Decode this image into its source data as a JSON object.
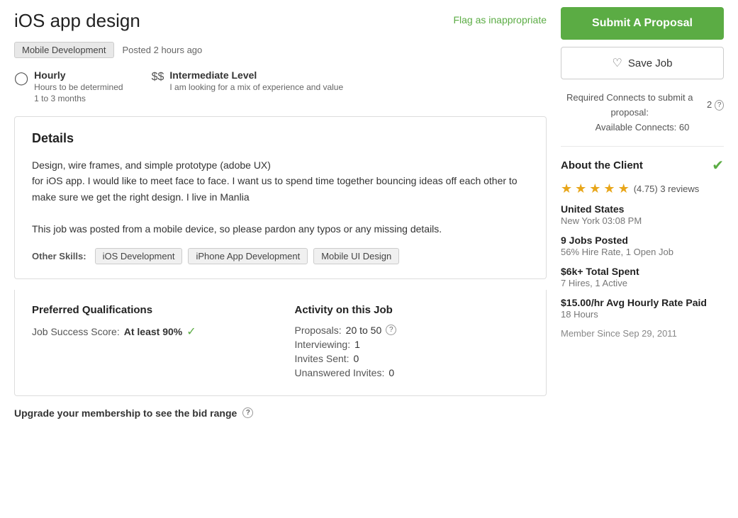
{
  "header": {
    "job_title": "iOS app design",
    "flag_label": "Flag as inappropriate"
  },
  "meta": {
    "category": "Mobile Development",
    "posted": "Posted 2 hours ago"
  },
  "job_type": {
    "type_label": "Hourly",
    "type_sub1": "Hours to be determined",
    "type_sub2": "1 to 3 months",
    "level_label": "Intermediate Level",
    "level_sub": "I am looking for a mix of experience and value"
  },
  "details": {
    "title": "Details",
    "description_line1": "Design, wire frames, and simple prototype (adobe UX)",
    "description_line2": "for iOS app. I would like to meet face to face.  I want us to spend time together bouncing ideas off each other to make sure we get the right design.  I live in Manlia",
    "description_line3": "",
    "description_line4": "This job was posted from a mobile device, so please pardon any typos or any missing details.",
    "other_skills_label": "Other Skills:",
    "skills": [
      "iOS Development",
      "iPhone App Development",
      "Mobile UI Design"
    ]
  },
  "qualifications": {
    "title": "Preferred Qualifications",
    "job_success_label": "Job Success Score:",
    "job_success_value": "At least 90%"
  },
  "activity": {
    "title": "Activity on this Job",
    "proposals_label": "Proposals:",
    "proposals_value": "20 to 50",
    "interviewing_label": "Interviewing:",
    "interviewing_value": "1",
    "invites_sent_label": "Invites Sent:",
    "invites_sent_value": "0",
    "unanswered_label": "Unanswered Invites:",
    "unanswered_value": "0"
  },
  "upgrade": {
    "text": "Upgrade your membership to see the bid range"
  },
  "sidebar": {
    "submit_label": "Submit A Proposal",
    "save_label": "Save Job",
    "connects_text1": "Required Connects to submit a proposal:",
    "connects_number": "2",
    "connects_available": "Available Connects: 60",
    "about_client": {
      "title": "About the Client",
      "rating": "4.75",
      "reviews": "3 reviews",
      "location": "United States",
      "time": "New York 03:08 PM",
      "jobs_posted_label": "9 Jobs Posted",
      "hire_rate": "56% Hire Rate, 1 Open Job",
      "total_spent_label": "$6k+ Total Spent",
      "hires": "7 Hires, 1 Active",
      "hourly_rate_label": "$15.00/hr Avg Hourly Rate Paid",
      "hours": "18 Hours",
      "member_since": "Member Since Sep 29, 2011"
    }
  }
}
